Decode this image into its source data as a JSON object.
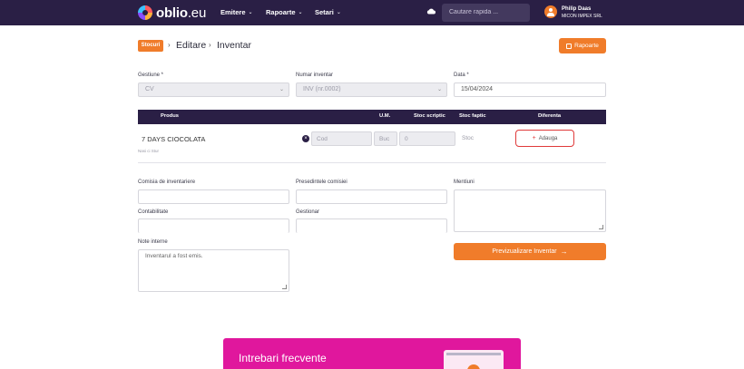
{
  "nav": {
    "logo_main": "oblio",
    "logo_tld": ".eu",
    "items": [
      {
        "label": "Emitere"
      },
      {
        "label": "Rapoarte"
      },
      {
        "label": "Setari"
      }
    ],
    "search_placeholder": "Cautare rapida ...",
    "user_name": "Philip Daas",
    "user_company": "MICON IMPEX SRL"
  },
  "header": {
    "crumb_stocuri": "Stocuri",
    "crumb_edit": "Editare",
    "crumb_page": "Inventar",
    "reports_label": "Rapoarte"
  },
  "form": {
    "gestiune_label": "Gestiune *",
    "gestiune_value": "CV",
    "numar_label": "Numar inventar",
    "numar_value": "INV (nr.0002)",
    "data_label": "Data *",
    "data_value": "15/04/2024"
  },
  "table": {
    "headers": [
      "Produs",
      "U.M.",
      "Stoc scriptic",
      "Stoc faptic",
      "Diferenta"
    ],
    "row": {
      "product": "7 DAYS CIOCOLATA",
      "cod": "Cod",
      "um": "Buc",
      "stoc_scriptic": "0",
      "stoc_faptic": "Stoc",
      "add_label": "Adauga"
    },
    "subnote": "Nasi ci Stur"
  },
  "bottom": {
    "comisia_label": "Comisia de inventariere",
    "presedinte_label": "Presedintele comisiei",
    "mentiuni_label": "Mentiuni",
    "contabilitate_label": "Contabilitate",
    "gestionar_label": "Gestionar",
    "note_label": "Note interne",
    "note_value": "Inventarul a fost emis.",
    "preview_label": "Previzualizare Inventar"
  },
  "faq": {
    "title": "Intrebari frecvente"
  },
  "colors": {
    "nav_bg": "#2a1f45",
    "accent": "#f07c2a",
    "faq_bg": "#e0179d",
    "highlight_border": "#e03a3a"
  }
}
